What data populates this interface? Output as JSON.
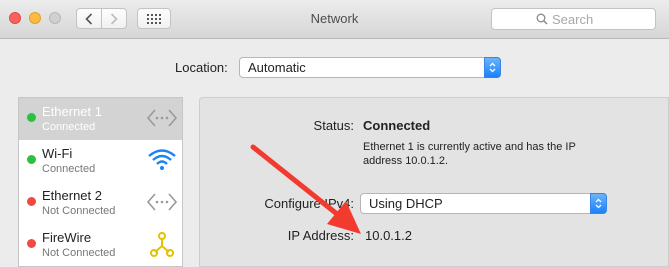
{
  "window": {
    "title": "Network"
  },
  "toolbar": {
    "search_placeholder": "Search"
  },
  "location": {
    "label": "Location:",
    "value": "Automatic"
  },
  "services": [
    {
      "name": "Ethernet 1",
      "status": "Connected",
      "state": "connected",
      "icon": "ethernet-icon",
      "selected": true
    },
    {
      "name": "Wi-Fi",
      "status": "Connected",
      "state": "connected",
      "icon": "wifi-icon",
      "selected": false
    },
    {
      "name": "Ethernet 2",
      "status": "Not Connected",
      "state": "disconnected",
      "icon": "ethernet-icon",
      "selected": false
    },
    {
      "name": "FireWire",
      "status": "Not Connected",
      "state": "disconnected",
      "icon": "firewire-icon",
      "selected": false
    }
  ],
  "detail": {
    "status_label": "Status:",
    "status_value": "Connected",
    "status_description": "Ethernet 1 is currently active and has the IP address 10.0.1.2.",
    "configure_label": "Configure IPv4:",
    "configure_value": "Using DHCP",
    "ip_label": "IP Address:",
    "ip_value": "10.0.1.2"
  },
  "colors": {
    "connected": "#29c23e",
    "disconnected": "#f24a42",
    "accent": "#1a82fb",
    "annotation_arrow": "#f23a2f"
  }
}
